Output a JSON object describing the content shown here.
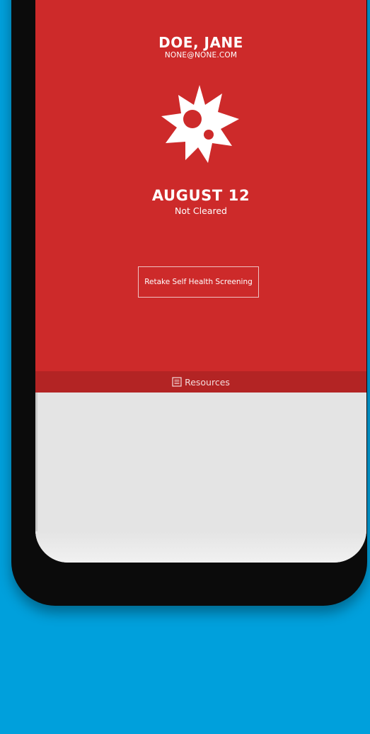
{
  "colors": {
    "background": "#00a0dc",
    "status_red": "#cd2a2a",
    "resources_bar": "#b32424",
    "content_bg": "#e4e4e4"
  },
  "profile": {
    "name": "DOE, JANE",
    "email": "NONE@NONE.COM"
  },
  "status_card": {
    "icon": "virus-icon",
    "date": "AUGUST 12",
    "status": "Not Cleared"
  },
  "actions": {
    "retake_label": "Retake Self Health Screening"
  },
  "bottom_nav": {
    "resources_icon": "document-icon",
    "resources_label": "Resources"
  }
}
